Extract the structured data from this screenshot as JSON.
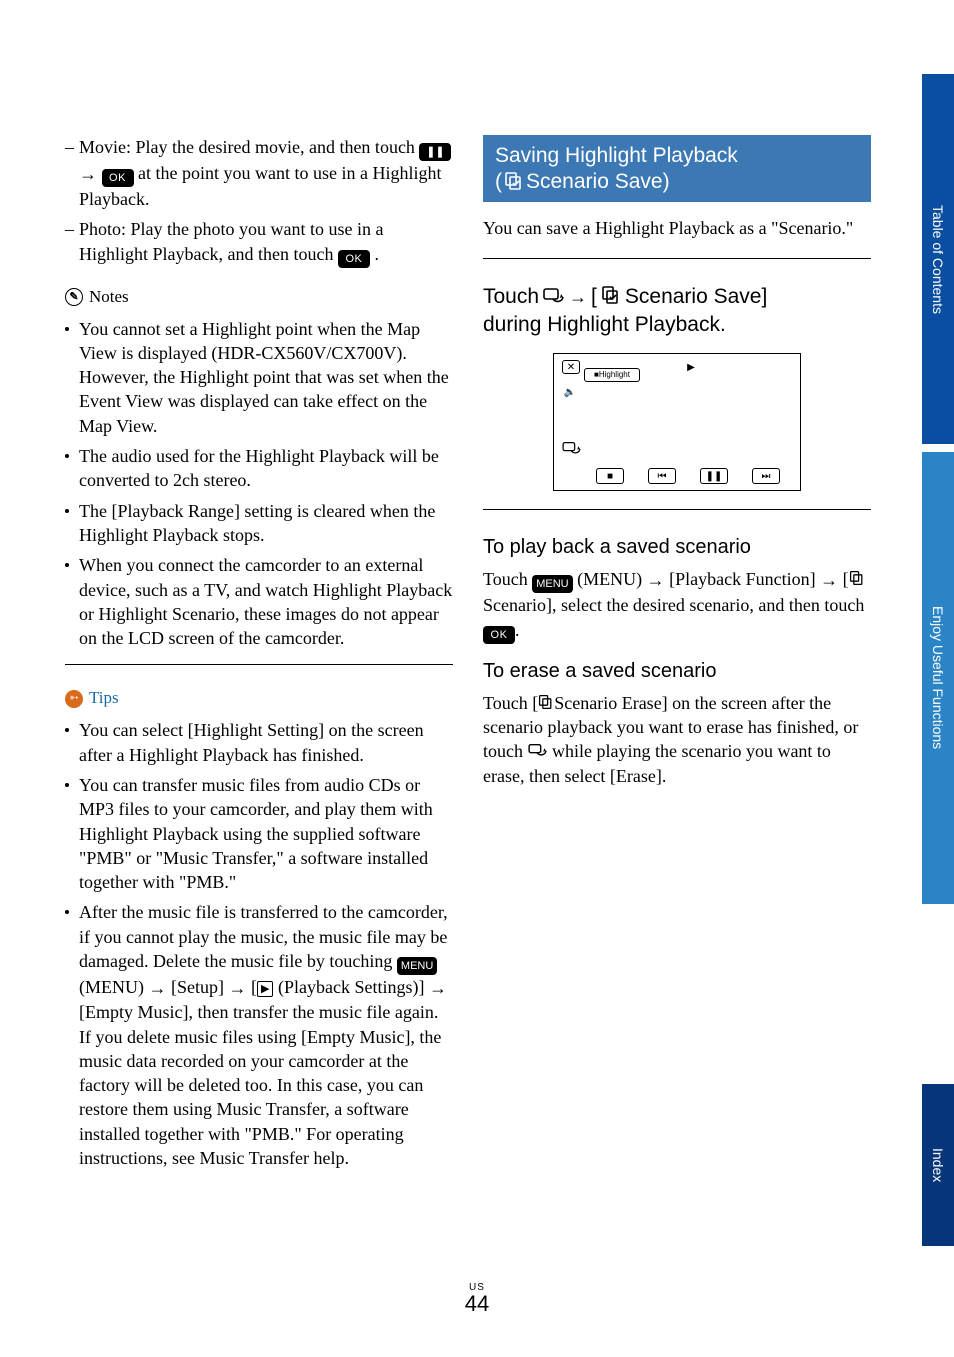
{
  "left": {
    "dash_items": [
      {
        "pre": "Movie: Play the desired movie, and then touch ",
        "pill1": "❚❚",
        "mid": " ",
        "pill2": "OK",
        "post": " at the point you want to use in a Highlight Playback."
      },
      {
        "pre": "Photo: Play the photo you want to use in a Highlight Playback, and then touch ",
        "pill1": "OK",
        "post": "."
      }
    ],
    "notes_label": "Notes",
    "notes": [
      "You cannot set a Highlight point when the Map View is displayed (HDR-CX560V/CX700V). However, the Highlight point that was set when the Event View was displayed can take effect on the Map View.",
      "The audio used for the Highlight Playback will be converted to 2ch stereo.",
      " The [Playback Range] setting is cleared when the Highlight Playback stops.",
      "When you connect the camcorder to an external device, such as a TV, and watch Highlight Playback or Highlight Scenario, these images do not appear on the LCD screen of the camcorder."
    ],
    "tips_label": "Tips",
    "tips": [
      {
        "text": "You can select [Highlight Setting] on the screen after a Highlight Playback has finished."
      },
      {
        "text": "You can transfer music files from audio CDs or MP3 files to your camcorder, and play them with Highlight Playback using the supplied software \"PMB\" or \"Music Transfer,\" a software installed together with \"PMB.\""
      },
      {
        "pre": "After the music file is transferred to the camcorder, if you cannot play the music, the music file may be damaged. Delete the music file by touching ",
        "menu_pill": "MENU",
        "after_menu": " (MENU) ",
        "arrow1": "→",
        "seg1": " [Setup] ",
        "arrow2": "→",
        "seg2_pre": " [",
        "play_icon": "▶",
        "seg2_post": " (Playback Settings)] ",
        "arrow3": "→",
        "seg3": " [Empty Music], then transfer the music file again. If you delete music files using [Empty Music], the music data recorded on your camcorder at the factory will be deleted too. In this case, you can restore them using Music Transfer, a software installed together with \"PMB.\" For operating instructions, see Music Transfer help."
      }
    ]
  },
  "right": {
    "banner_line1": "Saving Highlight Playback",
    "banner_line2": "Scenario Save)",
    "intro": "You can save a Highlight Playback as a \"Scenario.\"",
    "step_touch": "Touch",
    "step_arrow": "→",
    "step_bracket_open": " [",
    "step_scenario_save": "Scenario Save]",
    "step_line2": "during Highlight Playback.",
    "shot": {
      "close": "✕",
      "highlight_badge": "Highlight",
      "speaker": "🔈",
      "play": "▶",
      "action": "⤴",
      "stop": "■",
      "prev": "⏮",
      "pause": "❚❚",
      "next": "⏭"
    },
    "sub1": "To play back a saved scenario",
    "sub1_body_pre": "Touch ",
    "sub1_menu": "MENU",
    "sub1_after_menu": " (MENU) ",
    "sub1_arrow1": "→",
    "sub1_seg1": " [Playback Function] ",
    "sub1_arrow2": "→",
    "sub1_seg2_pre": " [",
    "sub1_seg2_post": "Scenario], select the desired scenario, and then touch ",
    "sub1_ok": "OK",
    "sub1_end": ".",
    "sub2": "To erase a saved scenario",
    "sub2_body_pre": "Touch [",
    "sub2_body_mid": "Scenario Erase] on the screen after the scenario playback you want to erase has finished, or touch ",
    "sub2_body_post": " while playing the scenario you want to erase, then select [Erase]."
  },
  "tabs": {
    "toc": "Table of Contents",
    "enjoy": "Enjoy Useful Functions",
    "index": "Index"
  },
  "footer": {
    "us": "US",
    "num": "44"
  }
}
